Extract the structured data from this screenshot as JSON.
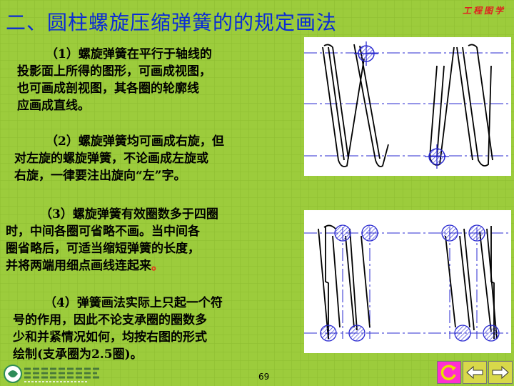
{
  "header": {
    "title": "二、圆柱螺旋压缩弹簧的的规定画法",
    "corner_label": "工程图学"
  },
  "paragraphs": [
    {
      "lines": [
        "（1）螺旋弹簧在平行于轴线的",
        "投影面上所得的图形，可画成视图，",
        "也可画成剖视图，其各圈的轮廓线",
        "应画成直线。"
      ]
    },
    {
      "lines": [
        "（2）螺旋弹簧均可画成右旋，但",
        "对左旋的螺旋弹簧，不论画成左旋或",
        "右旋，一律要注出旋向“左”字。"
      ]
    },
    {
      "lines": [
        "（3）螺旋弹簧有效圈数多于四圈",
        "时，中间各圈可省略不画。当中间各",
        "圈省略后，可适当缩短弹簧的长度，",
        "并将两端用细点画线连起来"
      ],
      "end_mark": "。"
    },
    {
      "lines": [
        "（4）弹簧画法实际上只起一个符",
        "号的作用，因此不论支承圈的圈数多",
        "少和并紧情况如何，均按右图的形式",
        "绘制(支承圈为2.5圈)。"
      ]
    }
  ],
  "footer": {
    "page_number": "69",
    "logo_icon": "university-logo-icon"
  },
  "colors": {
    "background": "#9ccc3c",
    "title": "#0a2bd6",
    "hatch_circle": "#2a2ad0",
    "button_refresh": "#ff2fd0",
    "button_nav": "#e8e000"
  }
}
